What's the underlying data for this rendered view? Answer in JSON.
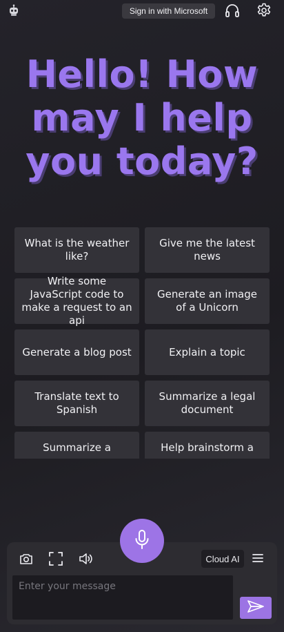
{
  "header": {
    "signin_label": "Sign in with Microsoft",
    "icons": [
      "robot-avatar-icon",
      "headset-icon",
      "gear-icon"
    ]
  },
  "hero": {
    "greeting": "Hello! How may I help you today?",
    "color": "#9a77ee"
  },
  "suggestions": [
    "What is the weather like?",
    "Give me the latest news",
    "Write some JavaScript code to make a request to an api",
    "Generate an image of a Unicorn",
    "Generate a blog post",
    "Explain a topic",
    "Translate text to Spanish",
    "Summarize a legal document",
    "Summarize a",
    "Help brainstorm a"
  ],
  "composer": {
    "mode_label": "Cloud AI",
    "placeholder": "Enter your message",
    "value": "",
    "accent": "#9d74e6",
    "icons": [
      "camera-icon",
      "fullscreen-icon",
      "speaker-icon",
      "microphone-icon",
      "menu-icon",
      "send-icon"
    ]
  }
}
